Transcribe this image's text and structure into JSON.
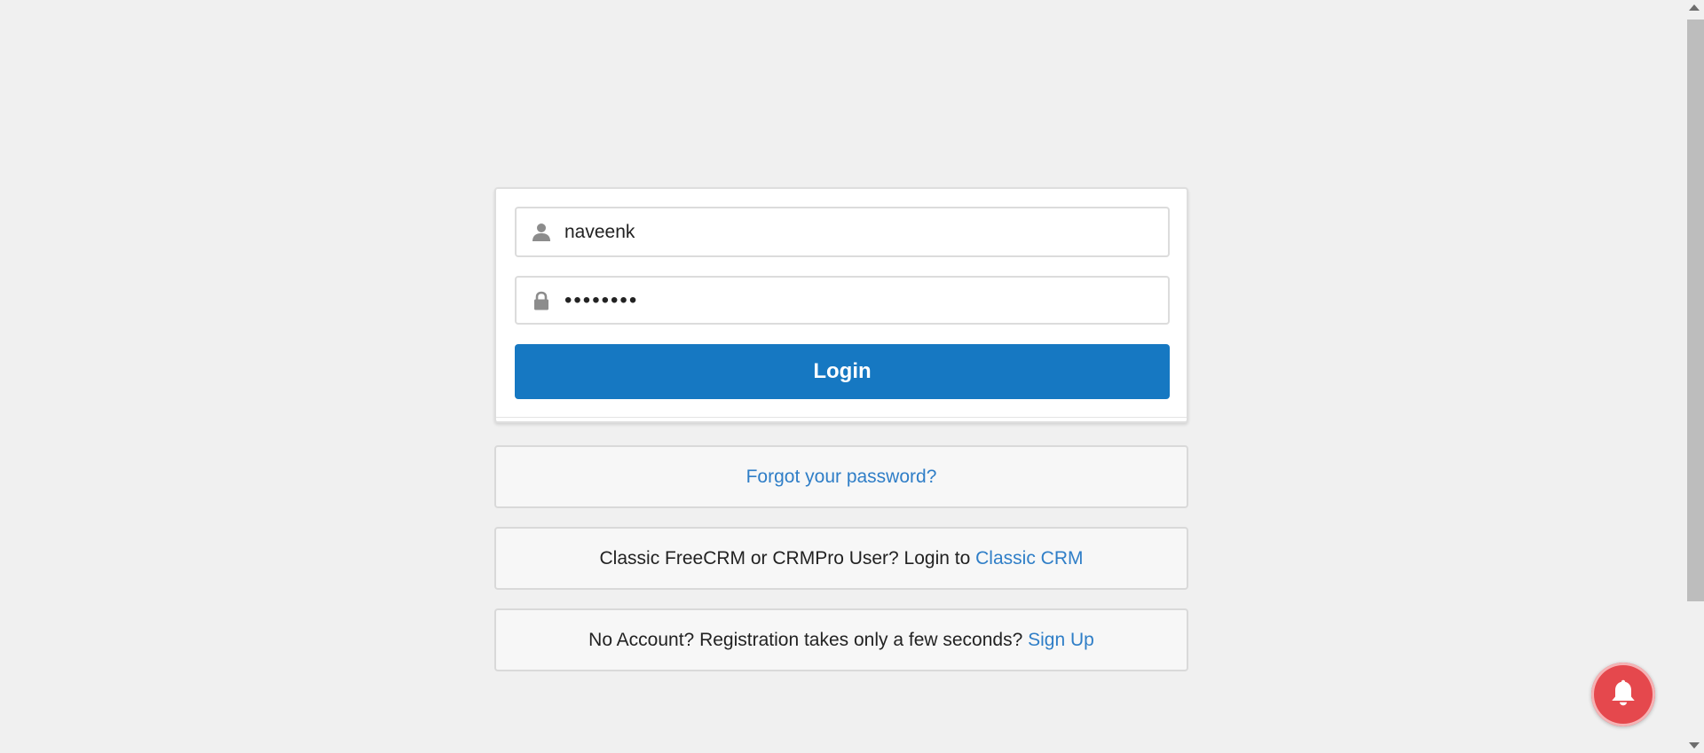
{
  "login_form": {
    "username": {
      "value": "naveenk",
      "icon": "user-icon"
    },
    "password": {
      "value": "••••••••",
      "icon": "lock-icon"
    },
    "login_button": "Login"
  },
  "forgot": {
    "link": "Forgot your password?"
  },
  "classic": {
    "text": "Classic FreeCRM or CRMPro User? Login to",
    "link": "Classic CRM"
  },
  "signup": {
    "text": "No Account? Registration takes only a few seconds?",
    "link": "Sign Up"
  },
  "notification": {
    "icon": "bell-icon",
    "color": "#e5484d"
  },
  "colors": {
    "primary": "#1678c2",
    "link": "#2f7ec7",
    "background": "#f0f0f0"
  }
}
